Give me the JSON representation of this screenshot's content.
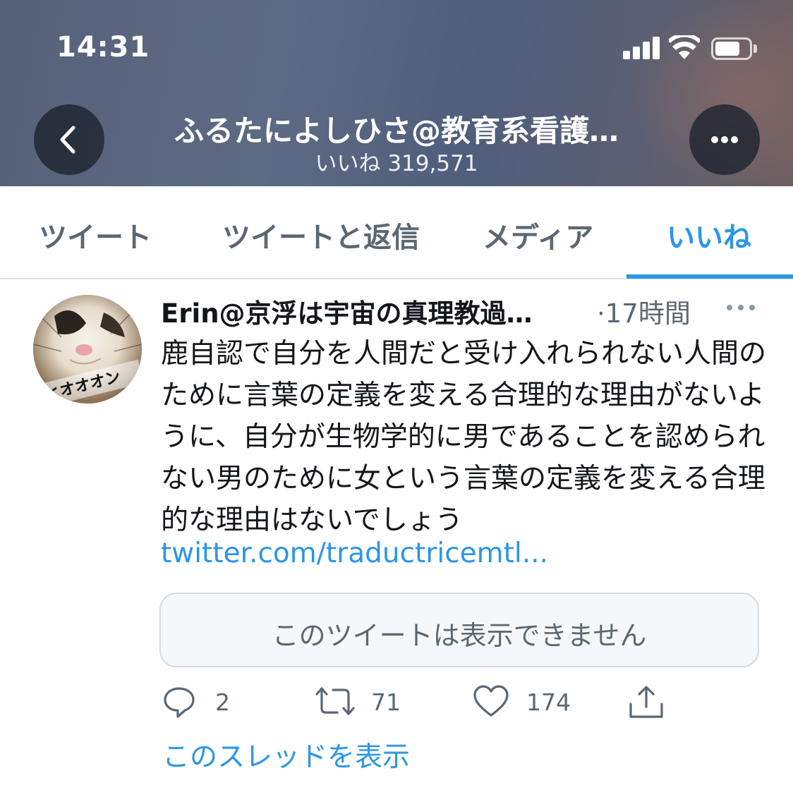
{
  "status_bar": {
    "time": "14:31"
  },
  "header": {
    "title": "ふるたによしひさ@教育系看護…",
    "subtitle": "いいね 319,571",
    "back_icon": "chevron-left-icon",
    "more_icon": "ellipsis-icon"
  },
  "tabs": [
    {
      "label": "ツイート",
      "active": false
    },
    {
      "label": "ツイートと返信",
      "active": false
    },
    {
      "label": "メディア",
      "active": false
    },
    {
      "label": "いいね",
      "active": true
    }
  ],
  "tweet": {
    "author_name": "Erin@京浮は宇宙の真理教過…",
    "time": "·17時間",
    "avatar_text": "ヒオオオン",
    "body": "鹿自認で自分を人間だと受け入れられない人間のために言葉の定義を変える合理的な理由がないように、自分が生物学的に男であることを認められない男のために女という言葉の定義を変える合理的な理由はないでしょう",
    "link": "twitter.com/traductricemtl...",
    "quote_unavailable": "このツイートは表示できません",
    "actions": {
      "reply_count": "2",
      "retweet_count": "71",
      "like_count": "174"
    },
    "show_thread": "このスレッドを表示"
  },
  "colors": {
    "accent": "#2b96e6",
    "secondary_text": "#5b6873",
    "primary_text": "#14171a"
  }
}
